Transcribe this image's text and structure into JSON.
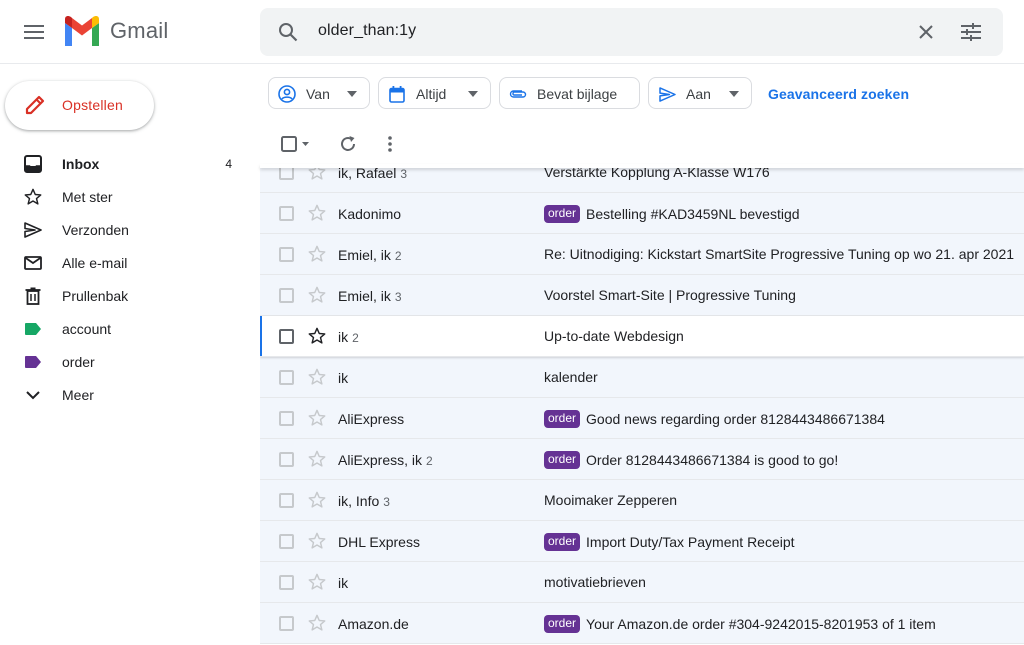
{
  "app": {
    "name": "Gmail"
  },
  "search": {
    "value": "older_than:1y"
  },
  "compose": {
    "label": "Opstellen"
  },
  "nav": [
    {
      "label": "Inbox",
      "count": "4",
      "icon": "inbox-icon",
      "bold": true
    },
    {
      "label": "Met ster",
      "count": "",
      "icon": "star-icon"
    },
    {
      "label": "Verzonden",
      "count": "",
      "icon": "send-icon"
    },
    {
      "label": "Alle e-mail",
      "count": "",
      "icon": "mail-icon"
    },
    {
      "label": "Prullenbak",
      "count": "",
      "icon": "trash-icon"
    },
    {
      "label": "account",
      "count": "",
      "icon": "label-icon",
      "color": "#16a765"
    },
    {
      "label": "order",
      "count": "",
      "icon": "label-icon",
      "color": "#653294"
    },
    {
      "label": "Meer",
      "count": "",
      "icon": "chevron-down-icon"
    }
  ],
  "filters": [
    {
      "label": "Van",
      "icon": "person-icon",
      "dropdown": true
    },
    {
      "label": "Altijd",
      "icon": "calendar-icon",
      "dropdown": true
    },
    {
      "label": "Bevat bijlage",
      "icon": "attachment-icon",
      "dropdown": false
    },
    {
      "label": "Aan",
      "icon": "send-icon",
      "dropdown": true
    }
  ],
  "advanced_search": "Geavanceerd zoeken",
  "colors": {
    "accent": "#1a73e8",
    "compose_red": "#d93025",
    "order_label": "#653294",
    "account_label": "#16a765",
    "unread_row": "#f2f6fc"
  },
  "emails": [
    {
      "sender": "ik, Rafael",
      "count": "3",
      "label": "",
      "subject": "Verstärkte Kopplung A-Klasse W176",
      "white": false
    },
    {
      "sender": "Kadonimo",
      "count": "",
      "label": "order",
      "subject": "Bestelling #KAD3459NL bevestigd",
      "white": false
    },
    {
      "sender": "Emiel, ik",
      "count": "2",
      "label": "",
      "subject": "Re: Uitnodiging: Kickstart SmartSite Progressive Tuning op wo 21. apr 2021",
      "white": false
    },
    {
      "sender": "Emiel, ik",
      "count": "3",
      "label": "",
      "subject": "Voorstel Smart-Site | Progressive Tuning",
      "white": false
    },
    {
      "sender": "ik",
      "count": "2",
      "label": "",
      "subject": "Up-to-date Webdesign",
      "white": true,
      "selected": true
    },
    {
      "sender": "ik",
      "count": "",
      "label": "",
      "subject": "kalender",
      "white": false
    },
    {
      "sender": "AliExpress",
      "count": "",
      "label": "order",
      "subject": "Good news regarding order 8128443486671384",
      "white": false
    },
    {
      "sender": "AliExpress, ik",
      "count": "2",
      "label": "order",
      "subject": "Order 8128443486671384 is good to go!",
      "white": false
    },
    {
      "sender": "ik, Info",
      "count": "3",
      "label": "",
      "subject": "Mooimaker Zepperen",
      "white": false
    },
    {
      "sender": "DHL Express",
      "count": "",
      "label": "order",
      "subject": "Import Duty/Tax Payment Receipt",
      "white": false
    },
    {
      "sender": "ik",
      "count": "",
      "label": "",
      "subject": "motivatiebrieven",
      "white": false
    },
    {
      "sender": "Amazon.de",
      "count": "",
      "label": "order",
      "subject": "Your Amazon.de order #304-9242015-8201953 of 1 item",
      "white": false
    }
  ]
}
